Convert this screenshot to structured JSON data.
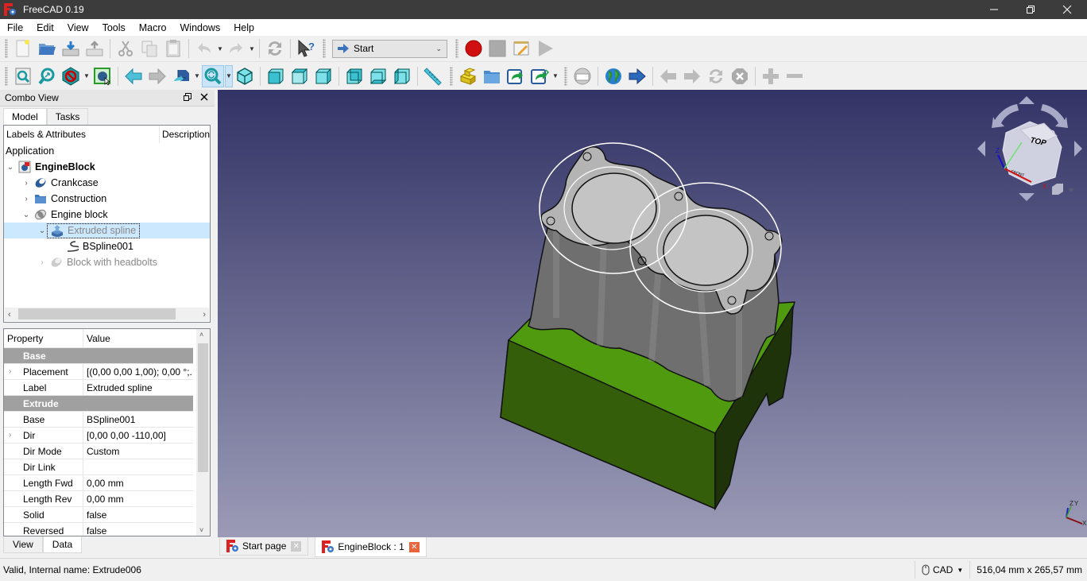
{
  "window": {
    "title": "FreeCAD 0.19",
    "controls": [
      "minimize",
      "restore",
      "close"
    ]
  },
  "menubar": [
    "File",
    "Edit",
    "View",
    "Tools",
    "Macro",
    "Windows",
    "Help"
  ],
  "toolbar1": {
    "file_icons": [
      "new-file-icon",
      "open-folder-icon",
      "save-icon",
      "save-as-icon"
    ],
    "edit_icons": [
      "cut-icon",
      "copy-icon",
      "paste-icon",
      "undo-icon",
      "redo-icon",
      "refresh-icon",
      "whats-this-icon"
    ],
    "workbench": "Start",
    "macro_icons": [
      "record-macro-icon",
      "stop-macro-icon",
      "edit-macro-icon",
      "run-macro-icon"
    ]
  },
  "toolbar2": {
    "view_icons": [
      "fit-all-icon",
      "fit-selection-icon",
      "draw-style-icon",
      "bounding-box-icon",
      "back-icon",
      "forward-icon",
      "sync-view-icon",
      "zoom-box-icon",
      "isometric-icon",
      "front-view-icon",
      "top-view-icon",
      "right-view-icon",
      "rear-view-icon",
      "bottom-view-icon",
      "left-view-icon",
      "measure-icon"
    ],
    "struct_icons": [
      "part-icon",
      "group-icon",
      "link-icon",
      "link-actions-icon"
    ],
    "web_icons": [
      "web-page-icon",
      "globe-icon",
      "navigate-icon",
      "web-back-icon",
      "web-forward-icon",
      "web-refresh-icon",
      "web-stop-icon",
      "zoom-in-icon",
      "zoom-out-icon"
    ]
  },
  "combo_view": {
    "title": "Combo View",
    "tabs": [
      "Model",
      "Tasks"
    ],
    "active_tab": "Model",
    "tree_headers": [
      "Labels & Attributes",
      "Description"
    ],
    "tree": [
      {
        "label": "Application",
        "level": 0,
        "expander": "",
        "icon": "",
        "state": "header"
      },
      {
        "label": "EngineBlock",
        "level": 0,
        "expander": "open",
        "icon": "document-icon",
        "state": "bold"
      },
      {
        "label": "Crankcase",
        "level": 1,
        "expander": "closed",
        "icon": "shape-icon",
        "state": "normal"
      },
      {
        "label": "Construction",
        "level": 1,
        "expander": "closed",
        "icon": "folder-icon",
        "state": "normal"
      },
      {
        "label": "Engine block",
        "level": 1,
        "expander": "open",
        "icon": "shape-icon",
        "state": "normal"
      },
      {
        "label": "Extruded spline",
        "level": 2,
        "expander": "open",
        "icon": "extrude-icon",
        "state": "selected-hidden"
      },
      {
        "label": "BSpline001",
        "level": 3,
        "expander": "",
        "icon": "bspline-icon",
        "state": "normal"
      },
      {
        "label": "Block with headbolts",
        "level": 2,
        "expander": "closed",
        "icon": "shape-icon",
        "state": "hidden"
      }
    ]
  },
  "property_editor": {
    "headers": [
      "Property",
      "Value"
    ],
    "rows": [
      {
        "type": "group",
        "name": "Base",
        "value": ""
      },
      {
        "type": "prop",
        "name": "Placement",
        "value": "[(0,00 0,00 1,00); 0,00 °;...",
        "expandable": true
      },
      {
        "type": "prop",
        "name": "Label",
        "value": "Extruded spline",
        "expandable": false
      },
      {
        "type": "group",
        "name": "Extrude",
        "value": ""
      },
      {
        "type": "prop",
        "name": "Base",
        "value": "BSpline001",
        "expandable": false
      },
      {
        "type": "prop",
        "name": "Dir",
        "value": "[0,00 0,00 -110,00]",
        "expandable": true
      },
      {
        "type": "prop",
        "name": "Dir Mode",
        "value": "Custom",
        "expandable": false
      },
      {
        "type": "prop",
        "name": "Dir Link",
        "value": "",
        "expandable": false
      },
      {
        "type": "prop",
        "name": "Length Fwd",
        "value": "0,00 mm",
        "expandable": false
      },
      {
        "type": "prop",
        "name": "Length Rev",
        "value": "0,00 mm",
        "expandable": false
      },
      {
        "type": "prop",
        "name": "Solid",
        "value": "false",
        "expandable": false
      },
      {
        "type": "prop",
        "name": "Reversed",
        "value": "false",
        "expandable": false
      }
    ],
    "bottom_tabs": [
      "View",
      "Data"
    ],
    "active_bottom_tab": "Data"
  },
  "viewport": {
    "navicube_face_top": "TOP",
    "navicube_face_front": "FRONT",
    "axis_labels": {
      "x": "X",
      "y": "Y",
      "z": "Z"
    },
    "colors": {
      "bg_top": "#333366",
      "bg_bottom": "#9b9bb7",
      "green": "#4f9a0e",
      "gray": "#8a8a8a"
    }
  },
  "document_tabs": [
    {
      "label": "Start page",
      "active": false
    },
    {
      "label": "EngineBlock : 1",
      "active": true
    }
  ],
  "statusbar": {
    "message": "Valid, Internal name: Extrude006",
    "nav_style": "CAD",
    "dimensions": "516,04 mm x 265,57 mm"
  }
}
